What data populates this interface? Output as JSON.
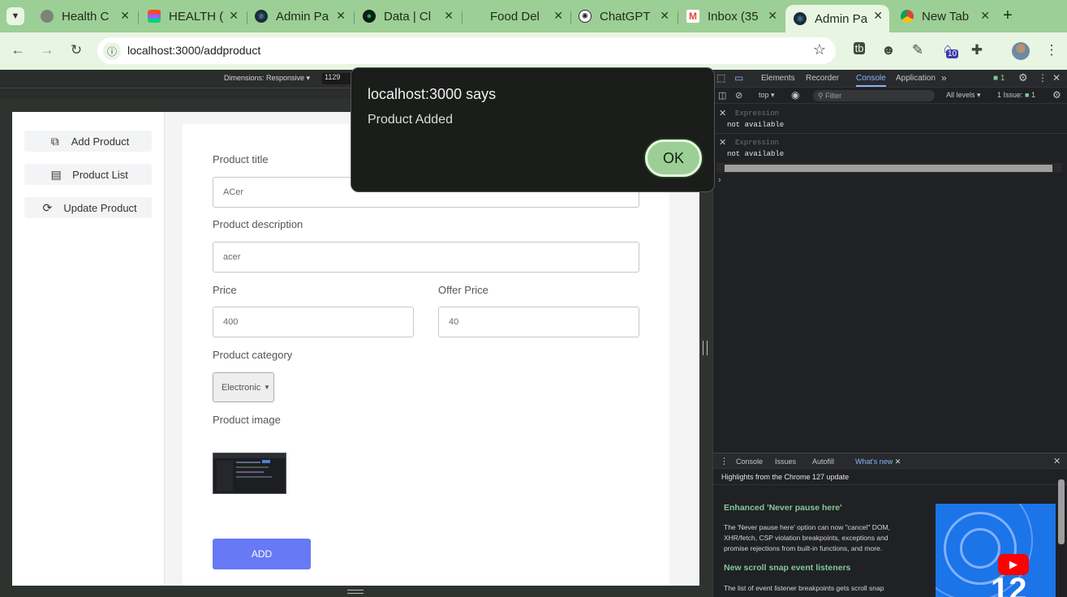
{
  "browser": {
    "tabs": [
      {
        "title": "Health C",
        "icon": "health-icon"
      },
      {
        "title": "HEALTH (",
        "icon": "figma-icon"
      },
      {
        "title": "Admin Pa",
        "icon": "react-icon"
      },
      {
        "title": "Data | Cl",
        "icon": "mongodb-icon"
      },
      {
        "title": "Food Del",
        "icon": "none"
      },
      {
        "title": "ChatGPT",
        "icon": "chatgpt-icon"
      },
      {
        "title": "Inbox (35",
        "icon": "gmail-icon"
      },
      {
        "title": "Admin Pa",
        "icon": "react-icon",
        "active": true
      },
      {
        "title": "New Tab",
        "icon": "chrome-icon"
      }
    ],
    "new_tab_glyph": "+",
    "url": "localhost:3000/addproduct",
    "extension_badge": "10",
    "accent_color": "#9ccf95"
  },
  "devtools_toolbar": {
    "dimensions_label": "Dimensions: Responsive ▾",
    "width_value": "1129"
  },
  "sidebar": {
    "items": [
      {
        "label": "Add Product",
        "icon": "add-product-icon"
      },
      {
        "label": "Product List",
        "icon": "product-list-icon"
      },
      {
        "label": "Update Product",
        "icon": "update-product-icon"
      }
    ]
  },
  "form": {
    "title_label": "Product title",
    "title_value": "ACer",
    "description_label": "Product description",
    "description_value": "acer",
    "price_label": "Price",
    "price_value": "400",
    "offer_label": "Offer Price",
    "offer_value": "40",
    "category_label": "Product category",
    "category_value": "Electronic",
    "image_label": "Product image",
    "submit_label": "ADD",
    "submit_color": "#6779f5"
  },
  "dialog": {
    "title": "localhost:3000 says",
    "message": "Product Added",
    "ok_label": "OK"
  },
  "devtools": {
    "tabs": [
      "Elements",
      "Recorder",
      "Console",
      "Application"
    ],
    "active_tab": "Console",
    "more_glyph": "»",
    "message_count": "1",
    "context": "top ▾",
    "filter_placeholder": "Filter",
    "levels": "All levels ▾",
    "issues": "1 Issue:",
    "issues_count": "1",
    "expressions": [
      {
        "label": "Expression",
        "value": "not available"
      },
      {
        "label": "Expression",
        "value": "not available"
      }
    ],
    "prompt": "›",
    "drawer_tabs": [
      "Console",
      "Issues",
      "Autofill",
      "What's new"
    ],
    "drawer_active": "What's new",
    "whats_new_header": "Highlights from the Chrome 127 update",
    "article1_title": "Enhanced 'Never pause here'",
    "article1_body": "The 'Never pause here' option can now \"cancel\" DOM, XHR/fetch, CSP violation breakpoints, exceptions and promise rejections from built-in functions, and more.",
    "article2_title": "New scroll snap event listeners",
    "article2_body": "The list of event listener breakpoints gets scroll snap",
    "video_text": "12"
  }
}
